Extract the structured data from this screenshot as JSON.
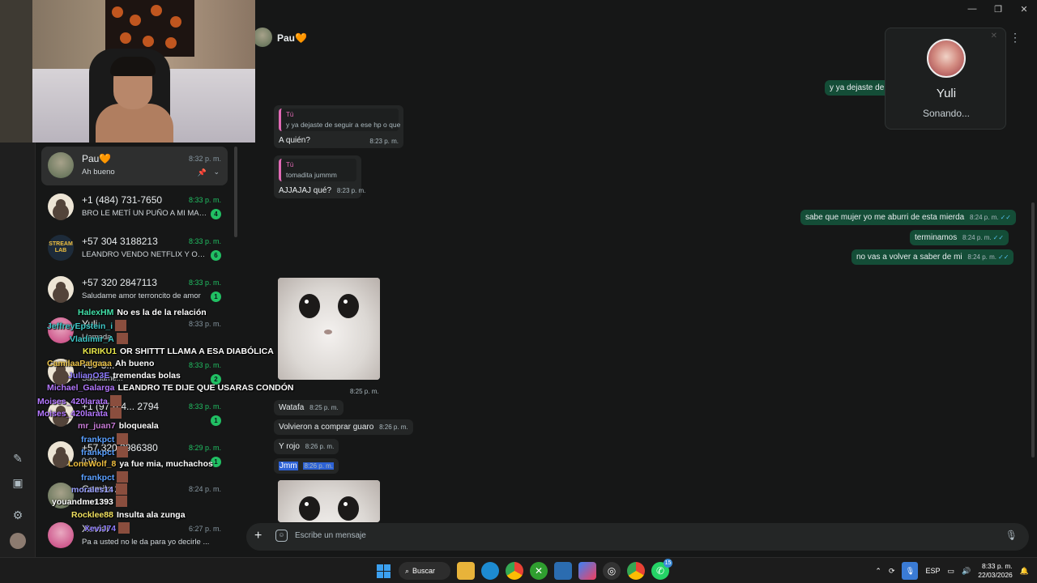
{
  "window_controls": {
    "minimize": "—",
    "maximize": "❐",
    "close": "✕"
  },
  "chat_list": {
    "items": [
      {
        "name": "Pau🧡",
        "time": "8:32 p. m.",
        "preview": "Ah bueno",
        "avatar": "photo",
        "active": true
      },
      {
        "name": "+1 (484) 731-7650",
        "time": "8:33 p. m.",
        "preview": "BRO LE METÍ UN PUÑO A MI MAM...",
        "badge": "4",
        "avatar": "default"
      },
      {
        "name": "+57 304 3188213",
        "time": "8:33 p. m.",
        "preview": "LEANDRO VENDO NETFLIX Y OTRA...",
        "badge": "6",
        "avatar": "logo"
      },
      {
        "name": "+57 320 2847113",
        "time": "8:33 p. m.",
        "preview": "Saludame amor terroncito de amor",
        "badge": "1",
        "avatar": "default"
      },
      {
        "name": "Yuli",
        "time": "8:33 p. m.",
        "preview": "Llamada",
        "avatar": "pink"
      },
      {
        "name": "+57 3...",
        "time": "8:33 p. m.",
        "preview": "Saludame...",
        "badge": "2",
        "avatar": "default"
      },
      {
        "name": "+1 (973) 4... 2794",
        "time": "8:33 p. m.",
        "preview": "",
        "badge": "1",
        "avatar": "default"
      },
      {
        "name": "+57 320 3986380",
        "time": "8:29 p. m.",
        "preview": "0:03",
        "badge": "1",
        "avatar": "default"
      },
      {
        "name": "Camilo 2",
        "time": "8:24 p. m.",
        "preview": "...an",
        "avatar": "photo"
      },
      {
        "name": "Xavier",
        "time": "6:27 p. m.",
        "preview": "Pa a usted no le da para yo decirle ...",
        "avatar": "pink"
      }
    ]
  },
  "stream_chat": [
    {
      "user": "HalexHM",
      "color": "#42e0a8",
      "text": "No es la de la relación"
    },
    {
      "user": "JeffreyEpstein_i",
      "color": "#3ec7c7",
      "text": ""
    },
    {
      "user": "Vladimir_A",
      "color": "#3ec7c7",
      "text": ""
    },
    {
      "user": "KIRIKU1",
      "color": "#e8e84a",
      "text": "OR SHITTT LLAMA A ESA DIABÓLICA"
    },
    {
      "user": "CamilaaPalgaaa",
      "color": "#e8c14a",
      "text": "Ah bueno"
    },
    {
      "user": "JulianO3E",
      "color": "#8f7cff",
      "text": "tremendas bolas"
    },
    {
      "user": "Michael_Galarga",
      "color": "#b478ff",
      "text": "LEANDRO TE DIJE QUE USARAS CONDÓN"
    },
    {
      "user": "Moises_420larata",
      "color": "#b478ff",
      "text": ""
    },
    {
      "user": "Moises_420larata",
      "color": "#b478ff",
      "text": ""
    },
    {
      "user": "mr_juan7",
      "color": "#c77bd6",
      "text": "bloqueala"
    },
    {
      "user": "frankpct",
      "color": "#5aa0ff",
      "text": ""
    },
    {
      "user": "frankpct",
      "color": "#5aa0ff",
      "text": ""
    },
    {
      "user": "LoneWolf_8",
      "color": "#f0c040",
      "text": "ya fue mia, muchachos"
    },
    {
      "user": "frankpct",
      "color": "#5aa0ff",
      "text": ""
    },
    {
      "user": "morales14",
      "color": "#9aa0ff",
      "text": ""
    },
    {
      "user": "youandme1393",
      "color": "#ffffff",
      "text": ""
    },
    {
      "user": "Rocklee88",
      "color": "#f0e060",
      "text": "Insulta ala zunga"
    },
    {
      "user": "XeviJ74",
      "color": "#8f7cff",
      "text": ""
    }
  ],
  "conversation": {
    "title": "Pau🧡",
    "messages": {
      "m1_quote_name": "Tú",
      "m1_quote_text": "y ya dejaste de seguir a ese hp o que",
      "m1_text": "A quién?",
      "m1_time": "8:23 p. m.",
      "m2_quote_name": "Tú",
      "m2_quote_text": "tomadita jummm",
      "m2_text": "AJJAJAJ qué?",
      "m2_time": "8:23 p. m.",
      "o0_text": "y ya dejaste de s",
      "o1_text": "sabe que mujer yo me aburri de esta mierda",
      "o1_time": "8:24 p. m.",
      "o2_text": "terminamos",
      "o2_time": "8:24 p. m.",
      "o3_text": "no vas a volver a saber de mi",
      "o3_time": "8:24 p. m.",
      "img1_time": "8:25 p. m.",
      "i3_text": "Watafa",
      "i3_time": "8:25 p. m.",
      "i4_text": "Volvieron a comprar guaro",
      "i4_time": "8:26 p. m.",
      "i5_text": "Y rojo",
      "i5_time": "8:26 p. m.",
      "i6_text": "Jmm",
      "i6_time": "8:26 p. m."
    },
    "composer_placeholder": "Escribe un mensaje"
  },
  "call_popup": {
    "name": "Yuli",
    "status": "Sonando..."
  },
  "taskbar": {
    "search_label": "Buscar",
    "lang": "ESP",
    "time": "8:33 p. m.",
    "date": "22/03/2026",
    "whatsapp_badge": "15"
  },
  "colors": {
    "accent": "#21c063",
    "outgoing": "#144d37",
    "incoming": "#242626",
    "quote_bar": "#e26ab6"
  }
}
